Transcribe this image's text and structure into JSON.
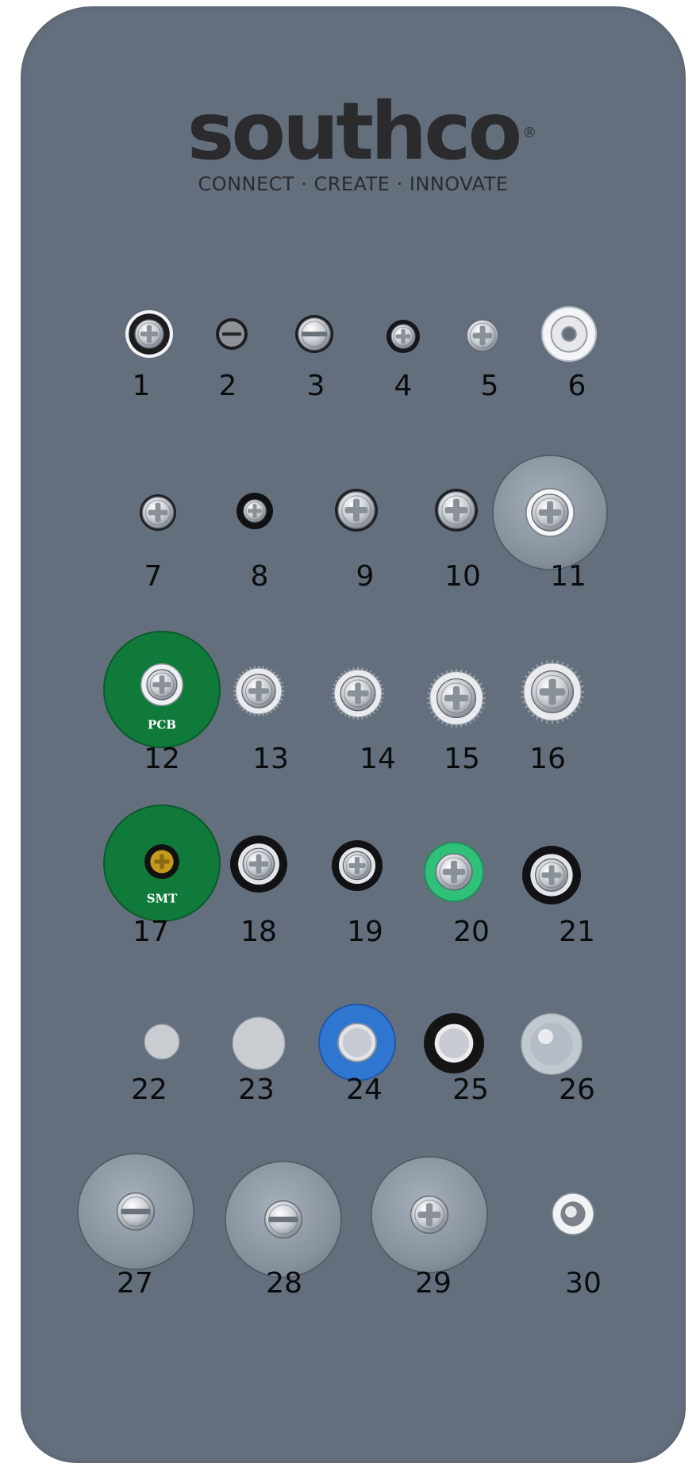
{
  "brand": {
    "name": "southco",
    "registered": "®",
    "tagline": "CONNECT · CREATE · INNOVATE"
  },
  "parts": [
    {
      "number": "1",
      "icon": "phillips-screw-black-ring-icon"
    },
    {
      "number": "2",
      "icon": "slotted-screw-small-icon"
    },
    {
      "number": "3",
      "icon": "slotted-screw-icon"
    },
    {
      "number": "4",
      "icon": "phillips-screw-small-icon"
    },
    {
      "number": "5",
      "icon": "phillips-screw-small-icon"
    },
    {
      "number": "6",
      "icon": "washer-ring-icon"
    },
    {
      "number": "7",
      "icon": "phillips-screw-icon"
    },
    {
      "number": "8",
      "icon": "phillips-screw-black-icon"
    },
    {
      "number": "9",
      "icon": "phillips-screw-icon"
    },
    {
      "number": "10",
      "icon": "phillips-screw-icon"
    },
    {
      "number": "11",
      "icon": "phillips-screw-large-plate-icon"
    },
    {
      "number": "12",
      "icon": "pcb-green-disc-screw-icon"
    },
    {
      "number": "13",
      "icon": "phillips-screw-knurled-icon"
    },
    {
      "number": "14",
      "icon": "phillips-screw-knurled-icon"
    },
    {
      "number": "15",
      "icon": "phillips-screw-knurled-icon"
    },
    {
      "number": "16",
      "icon": "phillips-screw-knurled-icon"
    },
    {
      "number": "17",
      "icon": "smt-green-disc-screw-icon"
    },
    {
      "number": "18",
      "icon": "phillips-screw-black-collar-icon"
    },
    {
      "number": "19",
      "icon": "phillips-screw-black-collar-icon"
    },
    {
      "number": "20",
      "icon": "phillips-screw-green-collar-icon"
    },
    {
      "number": "21",
      "icon": "phillips-screw-black-collar-icon"
    },
    {
      "number": "22",
      "icon": "plain-disc-small-icon"
    },
    {
      "number": "23",
      "icon": "plain-disc-icon"
    },
    {
      "number": "24",
      "icon": "blue-collar-disc-icon"
    },
    {
      "number": "25",
      "icon": "black-collar-disc-icon"
    },
    {
      "number": "26",
      "icon": "clear-dome-cap-icon"
    },
    {
      "number": "27",
      "icon": "slotted-screw-clear-plate-icon"
    },
    {
      "number": "28",
      "icon": "slotted-screw-clear-plate-icon"
    },
    {
      "number": "29",
      "icon": "phillips-screw-clear-plate-icon"
    },
    {
      "number": "30",
      "icon": "small-ring-screw-icon"
    }
  ],
  "disc_labels": {
    "pcb": "PCB",
    "smt": "SMT"
  },
  "colors": {
    "board": "#646f7e",
    "logo": "#2b2b2e",
    "pcb_green": "#0f7a3a",
    "collar_blue": "#2f76d1",
    "collar_green": "#2fc07a",
    "collar_black": "#141414"
  }
}
